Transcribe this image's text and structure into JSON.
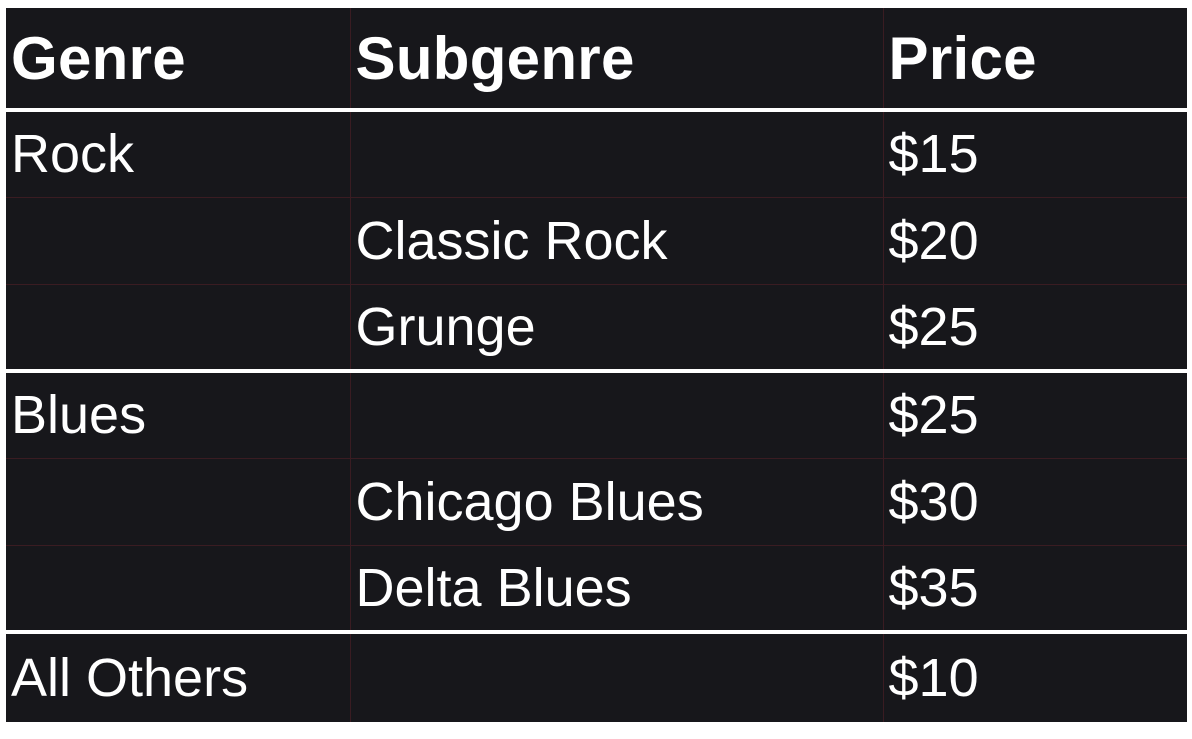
{
  "table": {
    "headers": {
      "genre": "Genre",
      "subgenre": "Subgenre",
      "price": "Price"
    },
    "rows": [
      {
        "genre": "Rock",
        "subgenre": "",
        "price": "$15"
      },
      {
        "genre": "",
        "subgenre": "Classic Rock",
        "price": "$20"
      },
      {
        "genre": "",
        "subgenre": "Grunge",
        "price": "$25"
      },
      {
        "genre": "Blues",
        "subgenre": "",
        "price": "$25"
      },
      {
        "genre": "",
        "subgenre": "Chicago Blues",
        "price": "$30"
      },
      {
        "genre": "",
        "subgenre": "Delta Blues",
        "price": "$35"
      },
      {
        "genre": "All Others",
        "subgenre": "",
        "price": "$10"
      }
    ]
  },
  "colors": {
    "background": "#17171b",
    "text": "#ffffff",
    "group_separator": "#ffffff",
    "cell_divider": "#3a1c22"
  }
}
